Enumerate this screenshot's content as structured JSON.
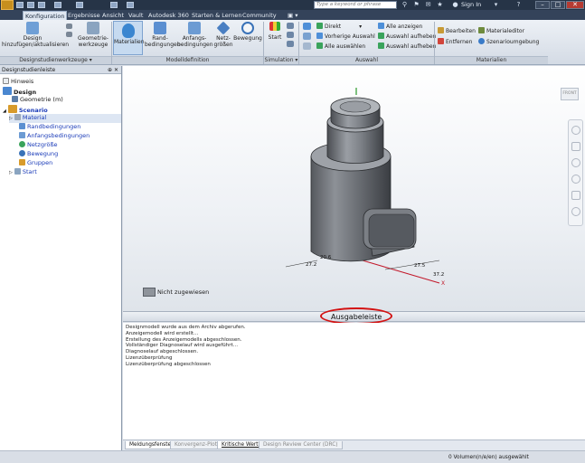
{
  "titlebar": {
    "search_placeholder": "Type a keyword or phrase",
    "signin_label": "Sign In"
  },
  "ribbon_tabs": [
    "Konfiguration",
    "Ergebnisse",
    "Ansicht",
    "Vault",
    "Autodesk 360",
    "Starten & Lernen",
    "Community"
  ],
  "ribbon": {
    "design_label": "Design\nhinzufügen/aktualisieren",
    "geometry_tools_label": "Geometrie-\nwerkzeuge",
    "materials_label": "Materialien",
    "boundary_label": "Rand-\nbedingungen",
    "initial_label": "Anfangs-\nbedingungen",
    "mesh_label": "Netz-\ngrößen",
    "motion_label": "Bewegung",
    "start_label": "Start",
    "groups": {
      "design_tools": "Designstudienwerkzeuge",
      "model_definition": "Modelldefinition",
      "simulation": "Simulation",
      "selection": "Auswahl",
      "materials": "Materialien"
    },
    "selection": {
      "direct": "Direkt",
      "previous": "Vorherige Auswahl",
      "select_all": "Alle auswählen",
      "show_all": "Alle anzeigen",
      "hide_selection_1": "Auswahl aufheben",
      "hide_selection_2": "Auswahl aufheben"
    },
    "materials_group": {
      "edit": "Bearbeiten",
      "material_editor": "Materialeditor",
      "remove": "Entfernen",
      "scenario_env": "Szenarioumgebung"
    }
  },
  "left_panel": {
    "title": "Designstudienleiste",
    "tree": [
      {
        "label": "Hinweis"
      },
      {
        "label": "Design"
      },
      {
        "label": "Geometrie (m)"
      },
      {
        "label": "Scenario"
      },
      {
        "label": "Material"
      },
      {
        "label": "Randbedingungen"
      },
      {
        "label": "Anfangsbedingungen"
      },
      {
        "label": "Netzgröße"
      },
      {
        "label": "Bewegung"
      },
      {
        "label": "Gruppen"
      },
      {
        "label": "Start"
      }
    ]
  },
  "viewport": {
    "viewcube_label": "FRONT",
    "legend_label": "Nicht zugewiesen",
    "dim_labels": [
      "20.6",
      "27.2",
      "27.5",
      "37.2"
    ],
    "axis_x": "X"
  },
  "output": {
    "title": "Ausgabeleiste",
    "lines": [
      "Designmodell wurde aus dem Archiv abgerufen.",
      "Anzeigemodell wird erstellt…",
      "Erstellung des Anzeigemodells abgeschlossen.",
      "Vollständiger Diagnoselauf wird ausgeführt…",
      "Diagnoselauf abgeschlossen.",
      "Lizenzüberprüfung",
      "Lizenzüberprüfung abgeschlossen"
    ],
    "tabs": [
      "Meldungsfenster",
      "Konvergenz-Plot",
      "Kritische Werte",
      "Design Review Center (DRC)"
    ]
  },
  "status": {
    "text": "0 Volumen(n/e/en) ausgewählt"
  },
  "colors": {
    "ring_highlight": "#d31212",
    "tree_link": "#1a3bb8",
    "ribbon_selected": "#c6daf0"
  }
}
